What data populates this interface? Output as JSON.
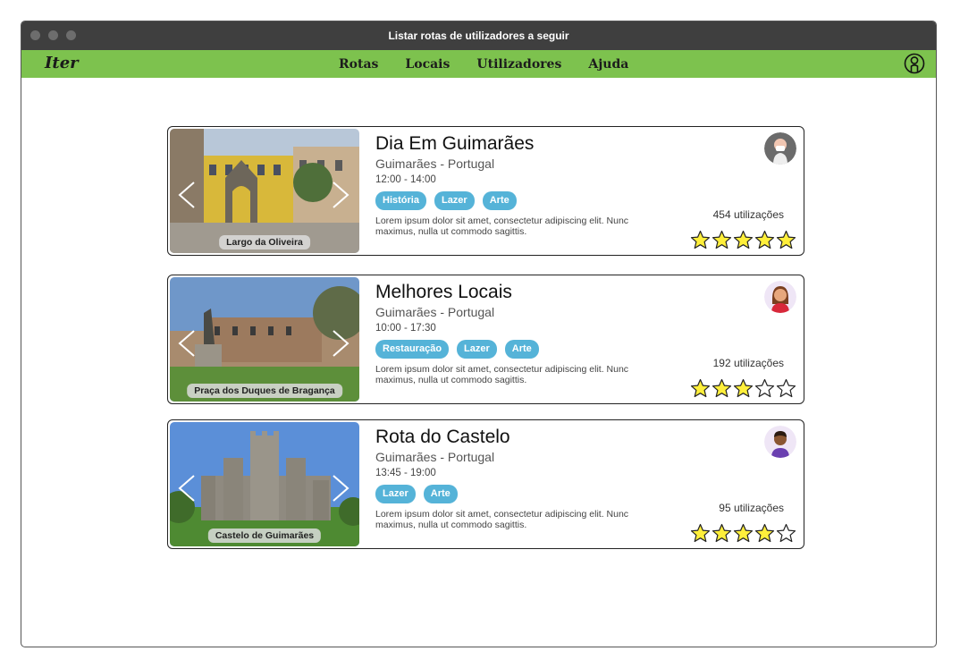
{
  "window": {
    "title": "Listar rotas de utilizadores a seguir"
  },
  "nav": {
    "logo": "Iter",
    "items": [
      {
        "label": "Rotas"
      },
      {
        "label": "Locais"
      },
      {
        "label": "Utilizadores"
      },
      {
        "label": "Ajuda"
      }
    ]
  },
  "colors": {
    "navbar": "#7dc24e",
    "titlebar": "#3f3f3f",
    "tag": "#55b3d8",
    "star_fill": "#ffef3b"
  },
  "routes": [
    {
      "title": "Dia Em Guimarães",
      "location": "Guimarães - Portugal",
      "time": "12:00 - 14:00",
      "tags": [
        "História",
        "Lazer",
        "Arte"
      ],
      "description": "Lorem ipsum dolor sit amet, consectetur adipiscing elit. Nunc maximus, nulla ut commodo sagittis.",
      "photo_caption": "Largo da Oliveira",
      "uses": "454 utilizações",
      "rating": 5,
      "avatar_icon": "woman-with-mask-avatar-icon"
    },
    {
      "title": "Melhores Locais",
      "location": "Guimarães - Portugal",
      "time": "10:00 - 17:30",
      "tags": [
        "Restauração",
        "Lazer",
        "Arte"
      ],
      "description": "Lorem ipsum dolor sit amet, consectetur adipiscing elit. Nunc maximus, nulla ut commodo sagittis.",
      "photo_caption": "Praça dos Duques de Bragança",
      "uses": "192 utilizações",
      "rating": 3,
      "avatar_icon": "woman-avatar-icon"
    },
    {
      "title": "Rota do Castelo",
      "location": "Guimarães - Portugal",
      "time": "13:45 - 19:00",
      "tags": [
        "Lazer",
        "Arte"
      ],
      "description": "Lorem ipsum dolor sit amet, consectetur adipiscing elit. Nunc maximus, nulla ut commodo sagittis.",
      "photo_caption": "Castelo de Guimarães",
      "uses": "95 utilizações",
      "rating": 4,
      "avatar_icon": "man-avatar-icon"
    }
  ]
}
